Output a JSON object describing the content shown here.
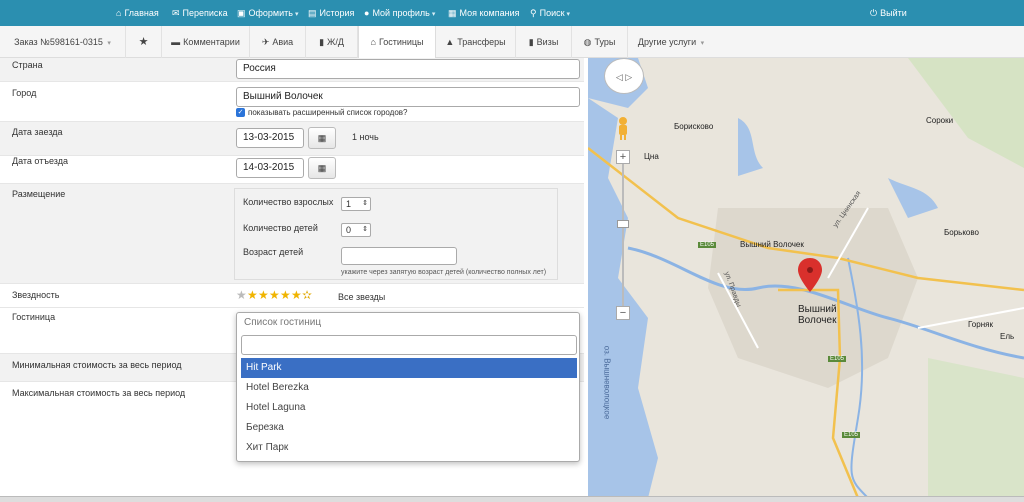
{
  "topnav": {
    "items": [
      {
        "icon": "home-icon",
        "glyph": "⌂",
        "label": "Главная",
        "caret": ""
      },
      {
        "icon": "envelope-icon",
        "glyph": "✉",
        "label": "Переписка",
        "caret": ""
      },
      {
        "icon": "cart-icon",
        "glyph": "▣",
        "label": "Оформить",
        "caret": "▾"
      },
      {
        "icon": "list-icon",
        "glyph": "▤",
        "label": "История",
        "caret": ""
      },
      {
        "icon": "user-icon",
        "glyph": "●",
        "label": "Мой профиль",
        "caret": "▾"
      },
      {
        "icon": "briefcase-icon",
        "glyph": "▦",
        "label": "Моя компания",
        "caret": ""
      },
      {
        "icon": "search-icon",
        "glyph": "⚲",
        "label": "Поиск",
        "caret": "▾"
      }
    ],
    "logout": {
      "icon": "power-icon",
      "glyph": "⏻",
      "label": "Выйти"
    }
  },
  "tabs": {
    "order": {
      "label": "Заказ №598161-0315",
      "caret": "▾"
    },
    "favorite_glyph": "★",
    "items": [
      {
        "name": "tab-comments",
        "icon": "comment-icon",
        "glyph": "▬",
        "label": "Комментарии"
      },
      {
        "name": "tab-avia",
        "icon": "plane-icon",
        "glyph": "✈",
        "label": "Авиа"
      },
      {
        "name": "tab-rail",
        "icon": "bookmark-icon",
        "glyph": "▮",
        "label": "Ж/Д"
      },
      {
        "name": "tab-hotels",
        "icon": "home-icon",
        "glyph": "⌂",
        "label": "Гостиницы"
      },
      {
        "name": "tab-transfers",
        "icon": "road-icon",
        "glyph": "▲",
        "label": "Трансферы"
      },
      {
        "name": "tab-visas",
        "icon": "book-icon",
        "glyph": "▮",
        "label": "Визы"
      },
      {
        "name": "tab-tours",
        "icon": "globe-icon",
        "glyph": "◍",
        "label": "Туры"
      }
    ],
    "other": {
      "label": "Другие услуги",
      "caret": "▾"
    }
  },
  "form": {
    "country": {
      "label": "Страна",
      "value": "Россия"
    },
    "city": {
      "label": "Город",
      "value": "Вышний Волочек",
      "checkbox_label": "показывать расширенный список городов?"
    },
    "checkin": {
      "label": "Дата заезда",
      "value": "13-03-2015",
      "nights": "1 ночь"
    },
    "checkout": {
      "label": "Дата отъезда",
      "value": "14-03-2015"
    },
    "placement": {
      "label": "Размещение",
      "adults_label": "Количество взрослых",
      "adults_value": "1",
      "children_label": "Количество детей",
      "children_value": "0",
      "ages_label": "Возраст детей",
      "ages_value": "",
      "ages_hint": "укажите через запятую возраст детей (количество полных лет)"
    },
    "stars": {
      "label": "Звездность",
      "text": "Все звезды"
    },
    "hotel": {
      "label": "Гостиница",
      "placeholder": "Список гостиниц"
    },
    "min_cost": {
      "label": "Минимальная стоимость за весь период"
    },
    "max_cost": {
      "label": "Максимальная стоимость за весь период"
    }
  },
  "dropdown": {
    "search_value": "",
    "options": [
      "Hit Park",
      "Hotel Berezka",
      "Hotel Laguna",
      "Березка",
      "Хит Парк"
    ],
    "selected": "Hit Park"
  },
  "map": {
    "labels": [
      "Борисково",
      "Цна",
      "Вышний Волочек",
      "Вышний Волочек",
      "Сороки",
      "Борьково",
      "Горняк",
      "Ель",
      "ул. Правды",
      "ул. Цнинская",
      "оз. Вышневолоцкое"
    ],
    "road_labels": [
      "E105",
      "E105",
      "E105"
    ]
  },
  "colors": {
    "topbar": "#2b8fb0",
    "selected": "#3a6fc4",
    "marker": "#d9302c"
  }
}
